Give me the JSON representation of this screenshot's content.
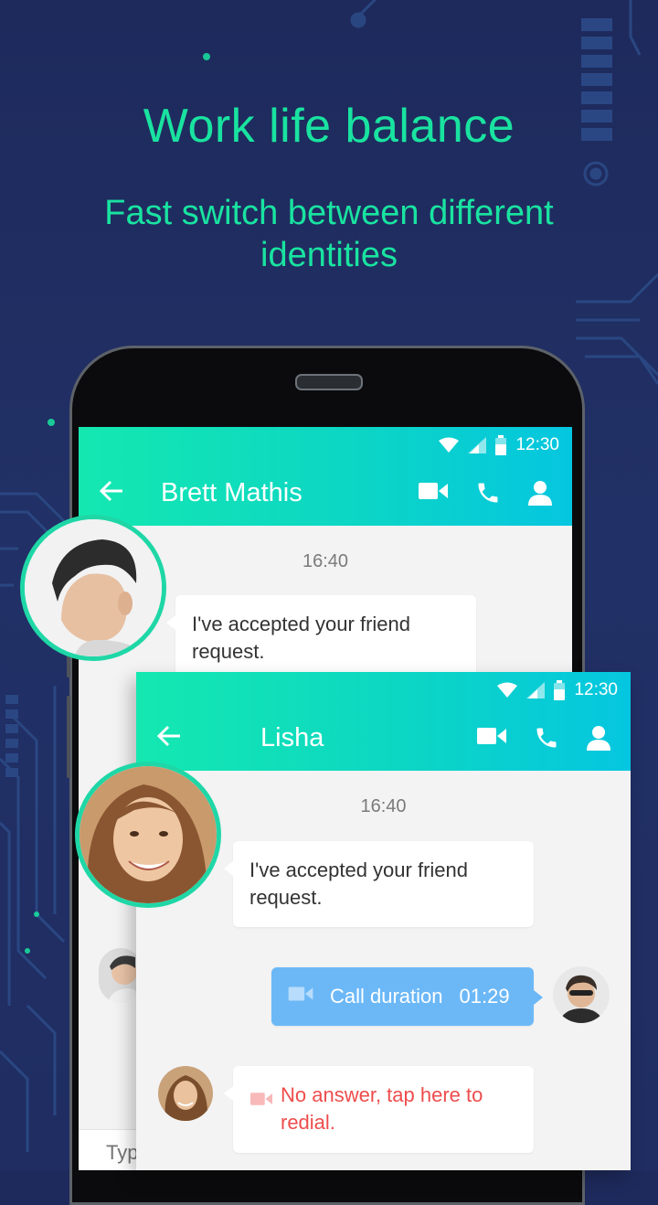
{
  "headline": {
    "title": "Work life balance",
    "subtitle": "Fast switch between different identities"
  },
  "status_bar": {
    "time": "12:30"
  },
  "back_chat": {
    "contact_name": "Brett Mathis",
    "timestamp": "16:40",
    "message": "I've accepted your friend request.",
    "input_placeholder": "Type"
  },
  "front_chat": {
    "contact_name": "Lisha",
    "timestamp": "16:40",
    "message": "I've accepted your friend request.",
    "call_label": "Call duration",
    "call_duration": "01:29",
    "missed_message": "No answer, tap here to redial."
  },
  "icons": [
    "back-arrow-icon",
    "video-call-icon",
    "phone-call-icon",
    "profile-icon",
    "wifi-icon",
    "signal-icon",
    "battery-icon"
  ],
  "colors": {
    "background": "#1f2d62",
    "accent_green": "#19e3a0",
    "appbar_start": "#14e8b0",
    "appbar_end": "#05c6e0",
    "outgoing_bubble": "#6cb8f7",
    "missed_text": "#ee4c4c"
  }
}
